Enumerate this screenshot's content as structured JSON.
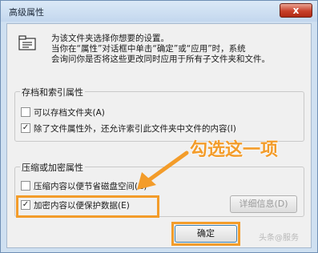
{
  "window": {
    "title": "高级属性",
    "close_label": "x"
  },
  "description": {
    "line1": "为该文件夹选择你想要的设置。",
    "line2": "当你在“属性”对话框中单击“确定”或“应用”时，系统",
    "line3": "会询问你是否将这些更改同时应用于所有子文件夹和文件。"
  },
  "archive_group": {
    "title": "存档和索引属性",
    "options": [
      {
        "label": "可以存档文件夹(A)",
        "checked": false
      },
      {
        "label": "除了文件属性外，还允许索引此文件夹中文件的内容(I)",
        "checked": true
      }
    ]
  },
  "compress_group": {
    "title": "压缩或加密属性",
    "options": [
      {
        "label": "压缩内容以便节省磁盘空间(C)",
        "checked": false
      },
      {
        "label": "加密内容以便保护数据(E)",
        "checked": true
      }
    ],
    "details_label": "详细信息(D)"
  },
  "footer": {
    "ok_label": "确定"
  },
  "annotation": {
    "text": "勾选这一项",
    "color": "#f39c2a"
  },
  "watermark": "头条@服务"
}
